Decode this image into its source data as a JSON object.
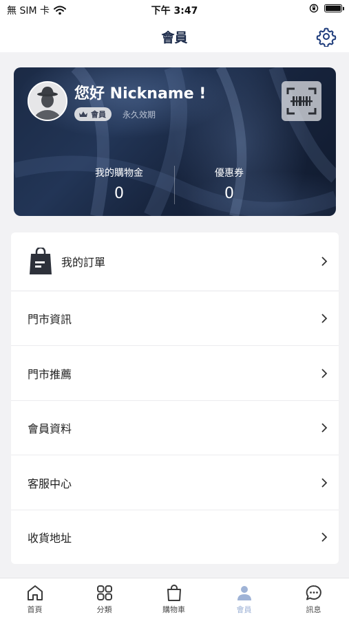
{
  "status_bar": {
    "carrier": "無 SIM 卡",
    "time": "下午 3:47"
  },
  "nav": {
    "title": "會員"
  },
  "member_card": {
    "greeting": "您好 Nickname !",
    "badge_label": "會員",
    "validity": "永久效期",
    "stats": [
      {
        "label": "我的購物金",
        "value": "0"
      },
      {
        "label": "優惠券",
        "value": "0"
      }
    ]
  },
  "menu": {
    "items": [
      {
        "label": "我的訂單",
        "icon": "shopping-bag-icon"
      },
      {
        "label": "門市資訊"
      },
      {
        "label": "門市推薦"
      },
      {
        "label": "會員資料"
      },
      {
        "label": "客服中心"
      },
      {
        "label": "收貨地址"
      }
    ]
  },
  "tab_bar": {
    "tabs": [
      {
        "label": "首頁",
        "icon": "home-icon"
      },
      {
        "label": "分類",
        "icon": "category-icon"
      },
      {
        "label": "購物車",
        "icon": "cart-bag-icon"
      },
      {
        "label": "會員",
        "icon": "user-icon",
        "active": true
      },
      {
        "label": "訊息",
        "icon": "chat-icon"
      }
    ]
  },
  "colors": {
    "nav_title": "#1c2b4a",
    "active_tab": "#9fb3d6",
    "card_dark": "#17243d"
  }
}
